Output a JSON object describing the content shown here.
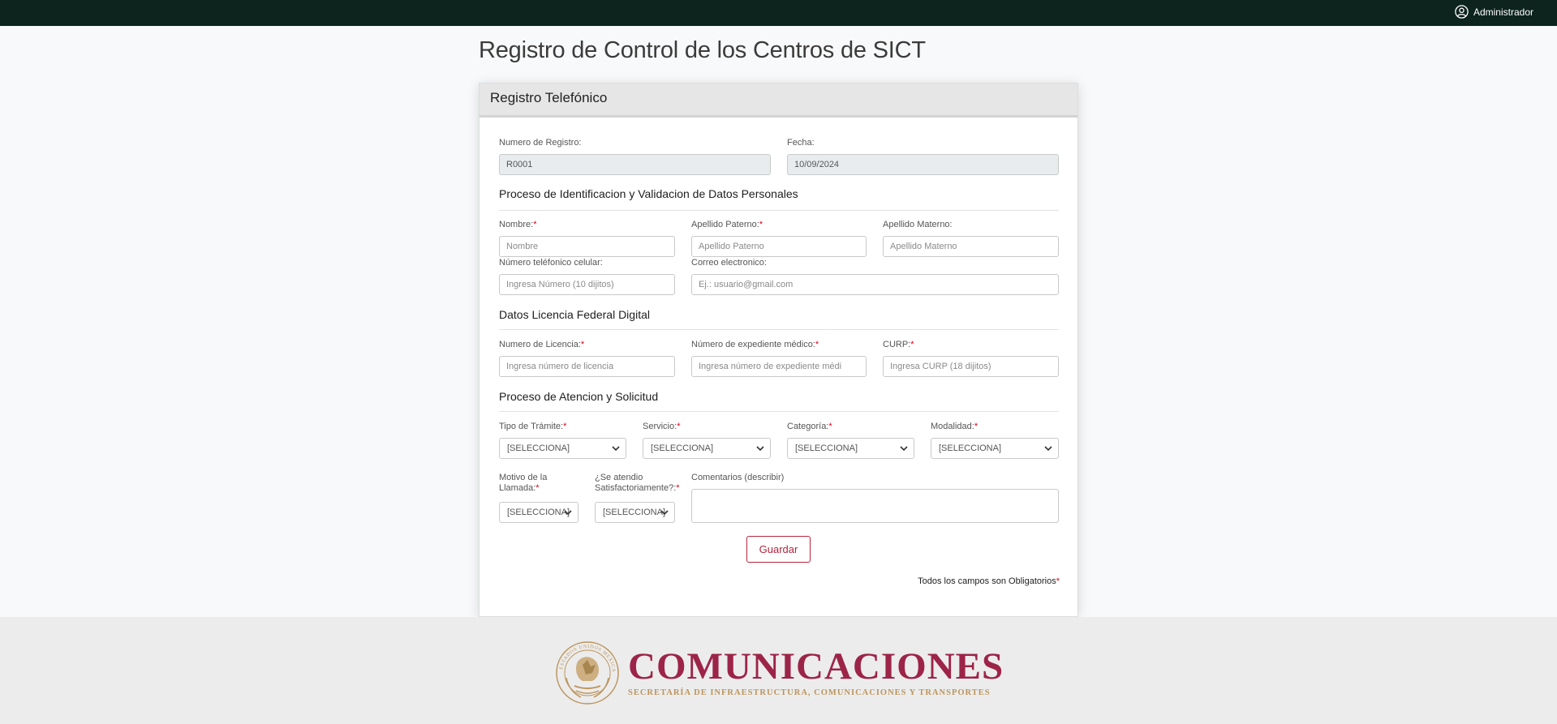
{
  "topbar": {
    "user_label": "Administrador",
    "user_icon": "user-circle-icon"
  },
  "page_title": "Registro de Control de los Centros de SICT",
  "card": {
    "header": "Registro Telefónico",
    "registro": {
      "label": "Numero de Registro:",
      "value": "R0001"
    },
    "fecha": {
      "label": "Fecha:",
      "value": "10/09/2024"
    },
    "section_personal": "Proceso de Identificacion y Validacion de Datos Personales",
    "nombre": {
      "label": "Nombre:",
      "required": "*",
      "placeholder": "Nombre"
    },
    "apellido_paterno": {
      "label": "Apellido Paterno:",
      "required": "*",
      "placeholder": "Apellido Paterno"
    },
    "apellido_materno": {
      "label": "Apellido Materno:",
      "placeholder": "Apellido Materno"
    },
    "telefono": {
      "label": "Número teléfonico celular:",
      "placeholder": "Ingresa Número (10 dijitos)"
    },
    "correo": {
      "label": "Correo electronico:",
      "placeholder": "Ej.: usuario@gmail.com"
    },
    "section_licencia": "Datos Licencia Federal Digital",
    "licencia": {
      "label": "Numero de Licencia:",
      "required": "*",
      "placeholder": "Ingresa número de licencia"
    },
    "expediente": {
      "label": "Número de expediente médico:",
      "required": "*",
      "placeholder": "Ingresa número de expediente médi"
    },
    "curp": {
      "label": "CURP:",
      "required": "*",
      "placeholder": "Ingresa CURP (18 dijitos)"
    },
    "section_atencion": "Proceso de Atencion y Solicitud",
    "tipo_tramite": {
      "label": "Tipo de Trámite:",
      "required": "*",
      "value": "[SELECCIONA]"
    },
    "servicio": {
      "label": "Servicio:",
      "required": "*",
      "value": "[SELECCIONA]"
    },
    "categoria": {
      "label": "Categoría:",
      "required": "*",
      "value": "[SELECCIONA]"
    },
    "modalidad": {
      "label": "Modalidad:",
      "required": "*",
      "value": "[SELECCIONA]"
    },
    "motivo": {
      "label_1": "Motivo de la",
      "label_2": "Llamada:",
      "required": "*",
      "value": "[SELECCIONA]"
    },
    "satisfactorio": {
      "label_1": "¿Se atendio",
      "label_2": "Satisfactoriamente?:",
      "required": "*",
      "value": "[SELECCIONA]"
    },
    "comentarios": {
      "label": "Comentarios (describir)",
      "value": ""
    },
    "save_label": "Guardar",
    "note": "Todos los campos son Obligatorios",
    "note_required": "*"
  },
  "footer": {
    "brand": "COMUNICACIONES",
    "subtitle": "SECRETARÍA DE INFRAESTRUCTURA, COMUNICACIONES Y TRANSPORTES",
    "seal_icon": "mexican-coat-of-arms-seal-icon",
    "seal_text": "ESTADOS UNIDOS MEXICANOS"
  },
  "colors": {
    "topbar": "#0c231e",
    "accent": "#b4263f",
    "brand": "#9d2449",
    "gold": "#bc955c",
    "required": "#d9001b"
  }
}
